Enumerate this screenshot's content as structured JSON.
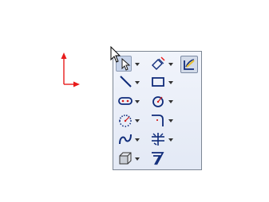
{
  "colors": {
    "palette_bg": "#e8ecf6",
    "palette_border": "#7d8794",
    "icon_blue": "#0f2b7a",
    "icon_red": "#d11a1a",
    "origin_red": "#e81b1b",
    "accent_yellow": "#e8c23a",
    "pressed_bg": "#c6d3ea"
  },
  "palette": {
    "rows": [
      [
        {
          "icon": "pointer-arrow-icon",
          "dropdown": true,
          "state": "pressed"
        },
        {
          "icon": "smart-dimension-icon",
          "dropdown": true
        },
        {
          "icon": "edit-sketch-icon",
          "dropdown": false,
          "state": "active"
        }
      ],
      [
        {
          "icon": "line-icon",
          "dropdown": true
        },
        {
          "icon": "rectangle-icon",
          "dropdown": true
        }
      ],
      [
        {
          "icon": "slot-icon",
          "dropdown": true
        },
        {
          "icon": "circle-icon",
          "dropdown": true
        }
      ],
      [
        {
          "icon": "arc-icon",
          "dropdown": true
        },
        {
          "icon": "fillet-icon",
          "dropdown": true
        }
      ],
      [
        {
          "icon": "spline-icon",
          "dropdown": true
        },
        {
          "icon": "trim-entities-icon",
          "dropdown": true
        }
      ],
      [
        {
          "icon": "convert-entities-icon",
          "dropdown": true
        },
        {
          "icon": "offset-entities-icon",
          "dropdown": false
        }
      ]
    ]
  }
}
